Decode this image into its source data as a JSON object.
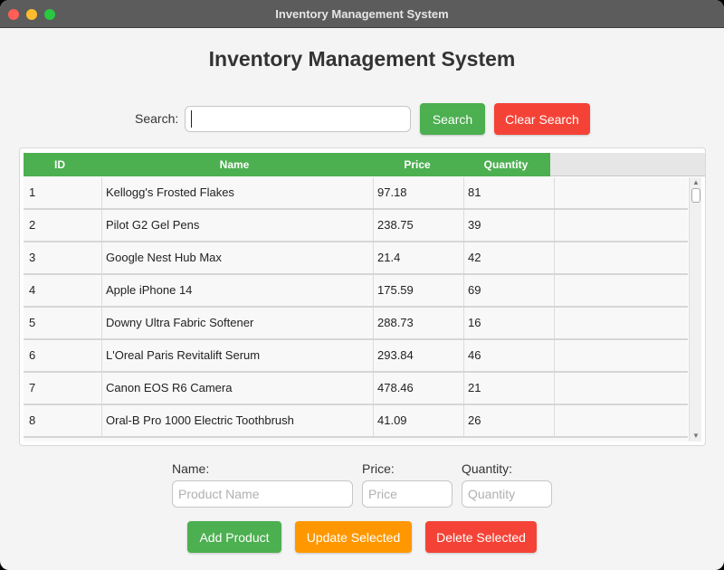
{
  "window": {
    "title": "Inventory Management System"
  },
  "header": {
    "title": "Inventory Management System"
  },
  "search": {
    "label": "Search:",
    "placeholder": "",
    "value": "",
    "search_button": "Search",
    "clear_button": "Clear Search"
  },
  "table": {
    "columns": [
      "ID",
      "Name",
      "Price",
      "Quantity"
    ],
    "rows": [
      [
        "1",
        "Kellogg's Frosted Flakes",
        "97.18",
        "81"
      ],
      [
        "2",
        "Pilot G2 Gel Pens",
        "238.75",
        "39"
      ],
      [
        "3",
        "Google Nest Hub Max",
        "21.4",
        "42"
      ],
      [
        "4",
        "Apple iPhone 14",
        "175.59",
        "69"
      ],
      [
        "5",
        "Downy Ultra Fabric Softener",
        "288.73",
        "16"
      ],
      [
        "6",
        "L'Oreal Paris Revitalift Serum",
        "293.84",
        "46"
      ],
      [
        "7",
        "Canon EOS R6 Camera",
        "478.46",
        "21"
      ],
      [
        "8",
        "Oral-B Pro 1000 Electric Toothbrush",
        "41.09",
        "26"
      ]
    ]
  },
  "form": {
    "name_label": "Name:",
    "name_placeholder": "Product Name",
    "price_label": "Price:",
    "price_placeholder": "Price",
    "quantity_label": "Quantity:",
    "quantity_placeholder": "Quantity"
  },
  "actions": {
    "add": "Add Product",
    "update": "Update Selected",
    "delete": "Delete Selected"
  },
  "colors": {
    "green": "#4caf50",
    "red": "#f44336",
    "orange": "#ff9800",
    "header_green": "#4caf50"
  }
}
